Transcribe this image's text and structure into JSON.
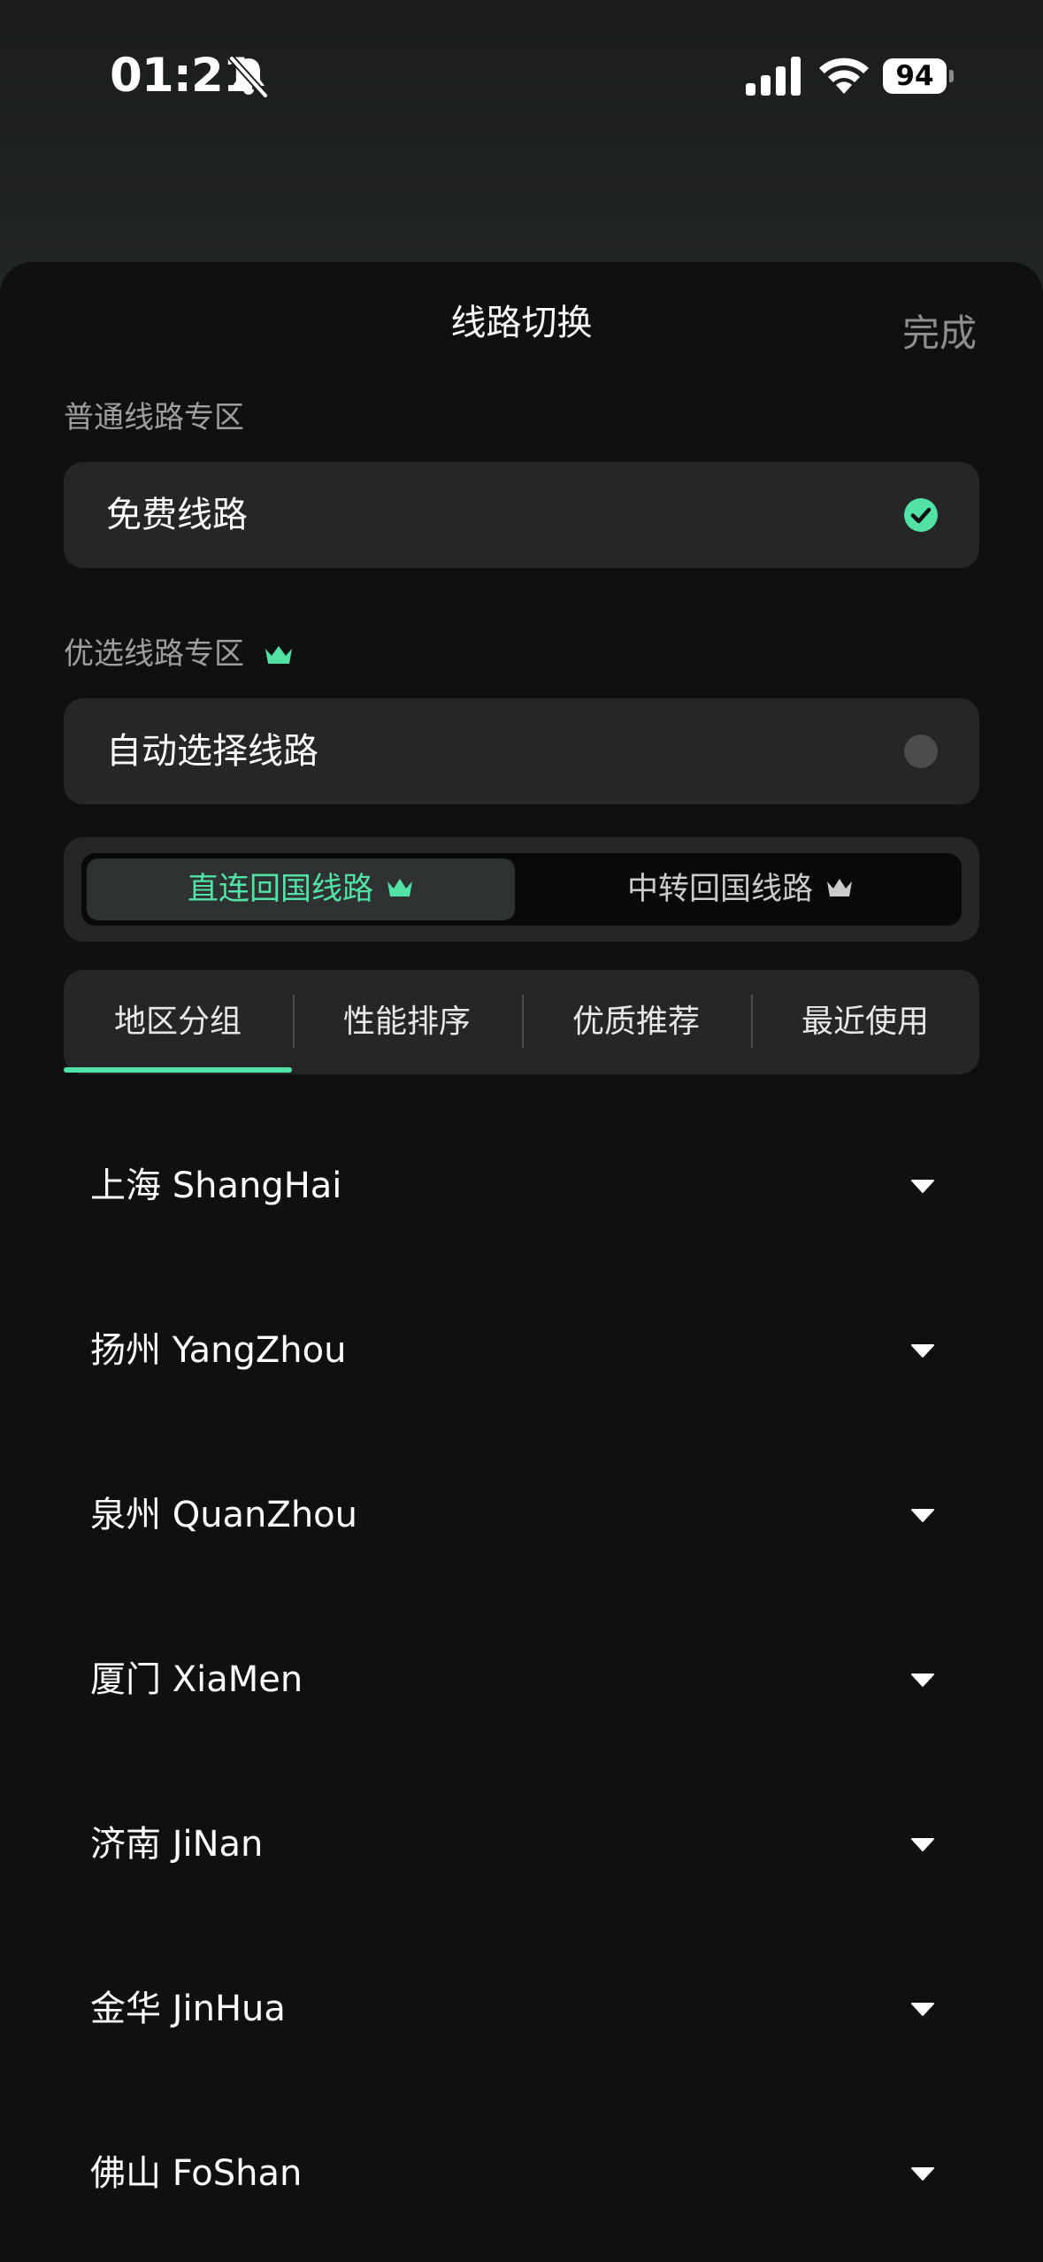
{
  "status_bar": {
    "time": "01:21",
    "battery": "94"
  },
  "sheet": {
    "title": "线路切换",
    "done_label": "完成"
  },
  "normal_section": {
    "label": "普通线路专区",
    "route_label": "免费线路",
    "selected": true
  },
  "premium_section": {
    "label": "优选线路专区",
    "route_label": "自动选择线路",
    "selected": false
  },
  "segments": [
    {
      "label": "直连回国线路",
      "active": true
    },
    {
      "label": "中转回国线路",
      "active": false
    }
  ],
  "tabs": [
    {
      "label": "地区分组",
      "active": true
    },
    {
      "label": "性能排序",
      "active": false
    },
    {
      "label": "优质推荐",
      "active": false
    },
    {
      "label": "最近使用",
      "active": false
    }
  ],
  "regions": [
    {
      "label": "上海 ShangHai"
    },
    {
      "label": "扬州 YangZhou"
    },
    {
      "label": "泉州 QuanZhou"
    },
    {
      "label": "厦门 XiaMen"
    },
    {
      "label": "济南 JiNan"
    },
    {
      "label": "金华 JinHua"
    },
    {
      "label": "佛山 FoShan"
    }
  ],
  "colors": {
    "accent": "#52e3a4",
    "sheet_bg": "#0f1111",
    "card_bg": "#242627",
    "muted_text": "#9c9e9f",
    "inactive_icon": "#4a4c4d"
  },
  "icons": {
    "mute": "bell-slash-icon",
    "signal": "cellular-signal-icon",
    "wifi": "wifi-icon",
    "check": "check-circle-icon",
    "crown": "crown-icon",
    "chevron": "chevron-down-icon"
  }
}
